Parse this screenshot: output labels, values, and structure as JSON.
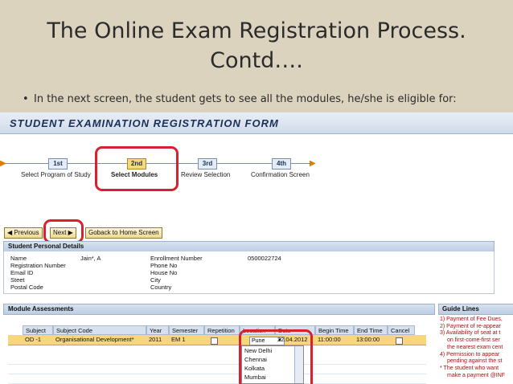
{
  "slide": {
    "title_line1": "The Online Exam Registration Process.",
    "title_line2": "Contd….",
    "bullet": "In the next screen, the student gets to see all the modules, he/she is eligible for:"
  },
  "form": {
    "title": "STUDENT EXAMINATION REGISTRATION FORM",
    "steps": [
      {
        "num": "1st",
        "label": "Select Program of Study"
      },
      {
        "num": "2nd",
        "label": "Select Modules"
      },
      {
        "num": "3rd",
        "label": "Review Selection"
      },
      {
        "num": "4th",
        "label": "Confirmation Screen"
      }
    ],
    "buttons": {
      "previous": "Previous",
      "next": "Next",
      "home": "Goback to Home Screen"
    },
    "personal": {
      "header": "Student Personal Details",
      "name_label": "Name",
      "name_value": "Jain*, A",
      "reg_label": "Registration Number",
      "email_label": "Email ID",
      "street_label": "Steet",
      "postal_label": "Postal Code",
      "enroll_label": "Enrollment Number",
      "enroll_value": "0500022724",
      "phone_label": "Phone No",
      "house_label": "House No",
      "city_label": "City",
      "country_label": "Country"
    },
    "modules": {
      "header": "Module Assessments",
      "columns": [
        "Subject",
        "Subject Code",
        "Year",
        "Semester",
        "Repetition",
        "Location",
        "Date",
        "Begin Time",
        "End Time",
        "Cancel"
      ],
      "row": {
        "subject": "OD -1",
        "code": "Organisational Development*",
        "year": "2011",
        "semester": "EM 1",
        "location": "Pune",
        "date": "22.04.2012",
        "begin": "11:00:00",
        "end": "13:00:00"
      },
      "location_options": [
        "New Delhi",
        "Chennai",
        "Kolkata",
        "Mumbai"
      ]
    },
    "guide": {
      "header": "Guide Lines",
      "lines": [
        "1) Payment of Fee Dues,",
        "2) Payment of re-appear",
        "3) Availability of seat at t",
        "on first-come-first ser",
        "the nearest exam cent",
        "4) Permission to appear",
        "pending against the st",
        "* The student who want",
        "make a payment @INF"
      ]
    }
  },
  "colors": {
    "highlight": "#d8202e",
    "accent": "#f6d77e"
  }
}
